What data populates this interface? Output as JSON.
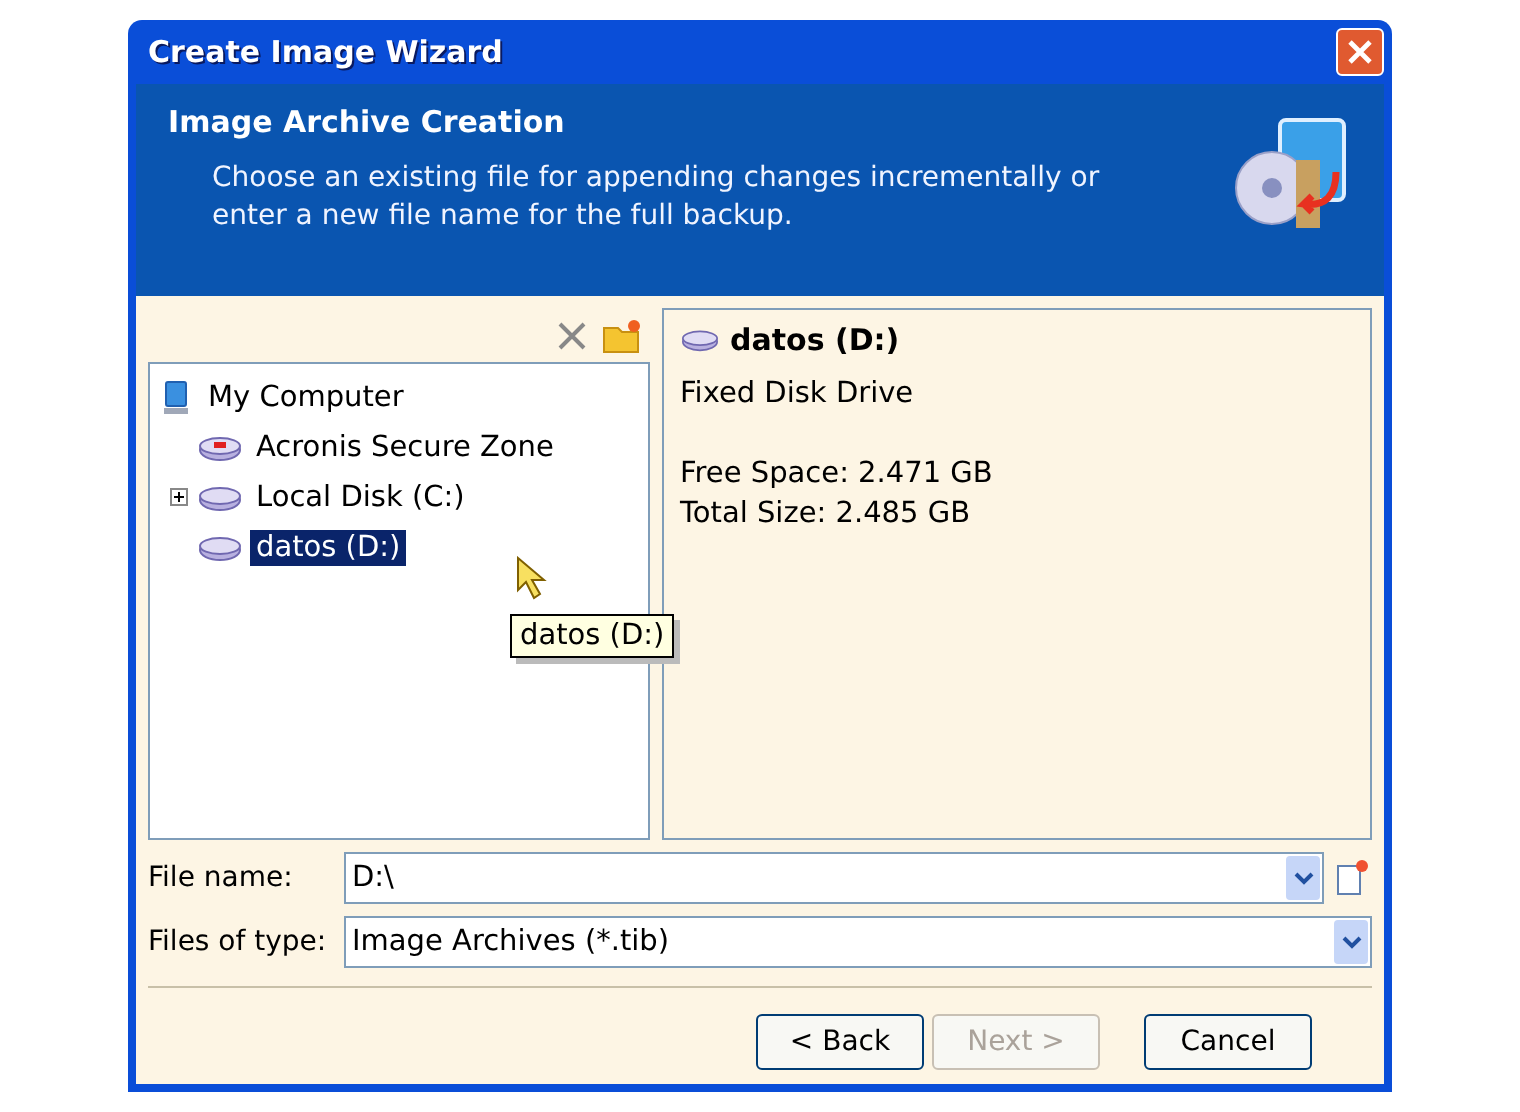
{
  "window": {
    "title": "Create Image Wizard"
  },
  "header": {
    "title": "Image Archive Creation",
    "description": "Choose an existing file for appending changes incrementally or enter a new file name for the full backup."
  },
  "tree": [
    {
      "label": "My Computer",
      "kind": "computer",
      "selected": false,
      "children": [
        {
          "label": "Acronis Secure Zone",
          "kind": "zone",
          "selected": false
        },
        {
          "label": "Local Disk (C:)",
          "kind": "disk",
          "selected": false,
          "expanded": false
        },
        {
          "label": "datos (D:)",
          "kind": "disk",
          "selected": true
        }
      ]
    }
  ],
  "tooltip": "datos (D:)",
  "details": {
    "title": "datos (D:)",
    "type": "Fixed Disk Drive",
    "free_space": "Free Space: 2.471 GB",
    "total_size": "Total Size: 2.485 GB"
  },
  "file_name": {
    "label": "File name:",
    "value": "D:\\"
  },
  "file_type": {
    "label": "Files of type:",
    "value": "Image Archives (*.tib)"
  },
  "buttons": [
    {
      "label": "< Back",
      "disabled": false
    },
    {
      "label": "Next >",
      "disabled": true
    },
    {
      "label": "Cancel",
      "disabled": false
    }
  ]
}
